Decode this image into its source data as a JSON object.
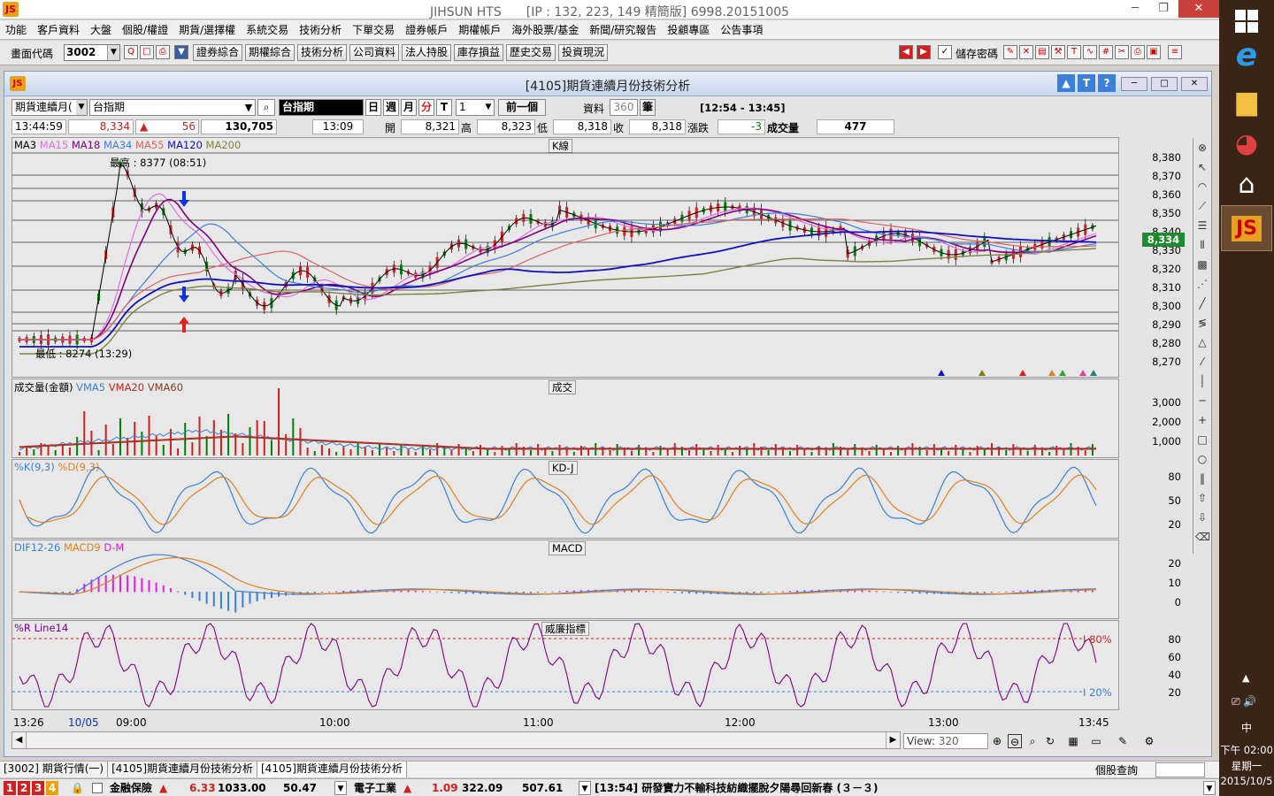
{
  "app": {
    "title": "JIHSUN HTS　　[IP : 132, 223, 149 精簡版] 6998.20151005",
    "minimize": "─",
    "restore": "❐",
    "close": "✕"
  },
  "menu": [
    "功能",
    "客戶資料",
    "大盤",
    "個股/權證",
    "期貨/選擇權",
    "系統交易",
    "技術分析",
    "下單交易",
    "證券帳戶",
    "期權帳戶",
    "海外股票/基金",
    "新聞/研究報告",
    "投顧專區",
    "公告事項"
  ],
  "toolbar": {
    "code_label": "畫面代碼",
    "code_value": "3002",
    "buttons": [
      "證券綜合",
      "期權綜合",
      "技術分析",
      "公司資料",
      "法人持股",
      "庫存損益",
      "歷史交易",
      "投資現況"
    ],
    "save_pwd_label": "儲存密碼"
  },
  "window": {
    "title": "[4105]期貨連續月份技術分析",
    "period_select": "期貨連續月(",
    "symbol": "台指期",
    "symbol_name": "台指期",
    "tf_day": "日",
    "tf_week": "週",
    "tf_month": "月",
    "tf_min": "分",
    "tf_tick": "T",
    "interval": "1",
    "prev": "前一個",
    "data_label": "資料",
    "data_count": "360",
    "data_unit": "筆",
    "range": "[12:54 - 13:45]"
  },
  "quote": {
    "time": "13:44:59",
    "price": "8,334",
    "change": "56",
    "volume_total": "130,705",
    "bar_time": "13:09",
    "open_label": "開",
    "open": "8,321",
    "high_label": "高",
    "high": "8,323",
    "low_label": "低",
    "low": "8,318",
    "close_label": "收",
    "close": "8,318",
    "chg_label": "漲跌",
    "chg": "-3",
    "vol_label": "成交量",
    "vol": "477"
  },
  "kpanel": {
    "legend": [
      "MA3",
      "MA15",
      "MA18",
      "MA34",
      "MA55",
      "MA120",
      "MA200"
    ],
    "legend_colors": [
      "#000000",
      "#e070e0",
      "#800080",
      "#3a7fd8",
      "#e06060",
      "#1010c0",
      "#808040"
    ],
    "title": "K線",
    "high_note": "最高 : 8377 (08:51)",
    "low_note": "最低 : 8274 (13:29)",
    "last_price": "8,334",
    "yticks": [
      "8,380",
      "8,370",
      "8,360",
      "8,350",
      "8,340",
      "8,330",
      "8,320",
      "8,310",
      "8,300",
      "8,290",
      "8,280",
      "8,270"
    ]
  },
  "vpanel": {
    "legend": [
      "成交量(金額)",
      "VMA5",
      "VMA20",
      "VMA60"
    ],
    "legend_colors": [
      "#000000",
      "#3a7fd8",
      "#d02020",
      "#804020"
    ],
    "title": "成交",
    "yticks": [
      "3,000",
      "2,000",
      "1,000"
    ]
  },
  "kdpanel": {
    "legend": [
      "%K(9,3)",
      "%D(9,3)"
    ],
    "legend_colors": [
      "#3a7fd8",
      "#e08020"
    ],
    "title": "KD-J",
    "yticks": [
      "80",
      "50",
      "20"
    ]
  },
  "macdpanel": {
    "legend": [
      "DIF12-26",
      "MACD9",
      "D-M"
    ],
    "legend_colors": [
      "#3a7fd8",
      "#e08020",
      "#d020d0"
    ],
    "title": "MACD",
    "yticks": [
      "20",
      "10",
      "0"
    ]
  },
  "wrpanel": {
    "legend": [
      "%R Line14"
    ],
    "legend_colors": [
      "#800080"
    ],
    "title": "威廉指標",
    "hi_line": "80%",
    "lo_line": "20%",
    "yticks": [
      "80",
      "60",
      "40",
      "20"
    ]
  },
  "xaxis": [
    "13:26",
    "10/05",
    "09:00",
    "10:00",
    "11:00",
    "12:00",
    "13:00",
    "13:45"
  ],
  "view": {
    "label": "View:",
    "value": "320"
  },
  "tabs": [
    "[3002]  期貨行情(一)",
    "[4105]期貨連續月份技術分析",
    "[4105]期貨連續月份技術分析"
  ],
  "stock_query": "個股查詢",
  "status": {
    "nums": [
      "1",
      "2",
      "3",
      "4"
    ],
    "sector1": "金融保險",
    "sector1_val": "6.33",
    "sector1_idx": "1033.00",
    "sector1_v": "50.47",
    "sector2": "電子工業",
    "sector2_val": "1.09",
    "sector2_idx": "322.09",
    "sector2_v": "507.61",
    "news": "[13:54]  研發實力不輸科技紡織擺脫夕陽尋回新春 (３－３)"
  },
  "clock": {
    "time": "下午 02:00",
    "day": "星期一",
    "date": "2015/10/5",
    "ime": "中"
  }
}
